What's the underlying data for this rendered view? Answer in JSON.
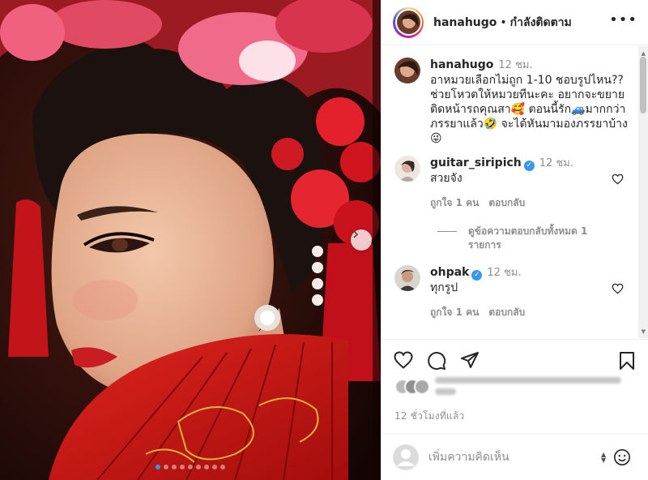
{
  "post": {
    "username": "hanahugo",
    "separator": "•",
    "follow_status": "กำลังติดตาม",
    "more_icon": "more-horizontal-icon",
    "carousel": {
      "slide_count": 9,
      "active_index": 0
    }
  },
  "caption": {
    "username": "hanahugo",
    "time": "12 ชม.",
    "line1": "อาหมวยเลือกไม่ถูก 1-10 ชอบรูปไหน??",
    "line2": "ช่วยโหวตให้หมวยทีนะคะ อยากจะขยายติดหน้ารถคุณสา🥰 ตอนนี้รัก🚙มากกว่าภรรยาแล้ว🤣 จะได้หันมามองภรรยาบ้าง 😜"
  },
  "comments": [
    {
      "username": "guitar_siripich",
      "verified": true,
      "time": "12 ชม.",
      "text": "สวยจัง",
      "likes_label": "ถูกใจ 1 คน",
      "reply_label": "ตอบกลับ"
    },
    {
      "username": "ohpak",
      "verified": true,
      "time": "12 ชม.",
      "text": "ทุกรูป",
      "likes_label": "ถูกใจ 1 คน",
      "reply_label": "ตอบกลับ"
    }
  ],
  "view_replies_label": "ดูข้อความตอบกลับทั้งหมด 1 รายการ",
  "actions": {
    "like_icon": "heart-icon",
    "comment_icon": "comment-icon",
    "share_icon": "send-icon",
    "save_icon": "bookmark-icon"
  },
  "time_ago": "12 ชั่วโมงที่แล้ว",
  "add_comment": {
    "placeholder": "เพิ่มความคิดเห็น",
    "emoji_icon": "emoji-icon"
  },
  "colors": {
    "verified": "#3897f0",
    "carousel_active_dot": "#2f96f5",
    "muted_text": "#8e8e8e",
    "primary_text": "#262626"
  }
}
